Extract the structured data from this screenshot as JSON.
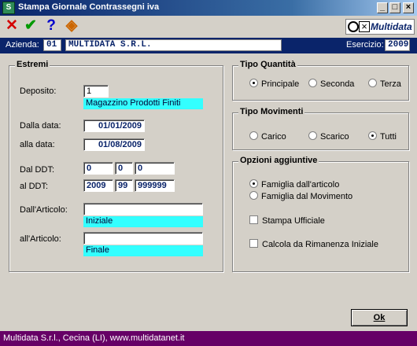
{
  "window": {
    "title": "Stampa Giornale Contrassegni iva",
    "app_icon_glyph": "S",
    "minimize_glyph": "_",
    "maximize_glyph": "□",
    "close_glyph": "×"
  },
  "toolbar": {
    "icons": [
      "close-x-icon",
      "check-icon",
      "help-icon",
      "print-icon"
    ],
    "close_glyph": "✕",
    "check_glyph": "✔",
    "help_glyph": "?",
    "print_glyph": "◈",
    "logo_text": "Multidata"
  },
  "company": {
    "azienda_label": "Azienda:",
    "azienda_code": "01",
    "azienda_name": "MULTIDATA S.R.L.",
    "esercizio_label": "Esercizio:",
    "esercizio_value": "2009"
  },
  "estremi": {
    "title": "Estremi",
    "deposito_label": "Deposito:",
    "deposito_value": "1",
    "deposito_hint": "Magazzino Prodotti Finiti",
    "dalla_data_label": "Dalla data:",
    "dalla_data_value": "01/01/2009",
    "alla_data_label": "alla data:",
    "alla_data_value": "01/08/2009",
    "dal_ddt_label": "Dal DDT:",
    "dal_ddt_values": [
      "0",
      "0",
      "0"
    ],
    "al_ddt_label": "al DDT:",
    "al_ddt_values": [
      "2009",
      "99",
      "999999"
    ],
    "dall_articolo_label": "Dall'Articolo:",
    "dall_articolo_value": "",
    "dall_articolo_hint": "Iniziale",
    "all_articolo_label": "all'Articolo:",
    "all_articolo_value": "",
    "all_articolo_hint": "Finale"
  },
  "tipo_quantita": {
    "title": "Tipo Quantità",
    "options": [
      "Principale",
      "Seconda",
      "Terza"
    ],
    "selected": "Principale"
  },
  "tipo_movimenti": {
    "title": "Tipo Movimenti",
    "options": [
      "Carico",
      "Scarico",
      "Tutti"
    ],
    "selected": "Tutti"
  },
  "opzioni": {
    "title": "Opzioni aggiuntive",
    "famiglia_options": [
      "Famiglia dall'articolo",
      "Famiglia dal Movimento"
    ],
    "famiglia_selected": "Famiglia dall'articolo",
    "checks": [
      {
        "label": "Stampa Ufficiale",
        "checked": false
      },
      {
        "label": "Calcola da Rimanenza Iniziale",
        "checked": false
      }
    ]
  },
  "buttons": {
    "ok_label": "Ok"
  },
  "status": {
    "text": "Multidata S.r.l., Cecina (LI), www.multidatanet.it"
  },
  "colors": {
    "accent": "#0a246a",
    "hint_bg": "#33ffff",
    "status_bg": "#660066"
  }
}
